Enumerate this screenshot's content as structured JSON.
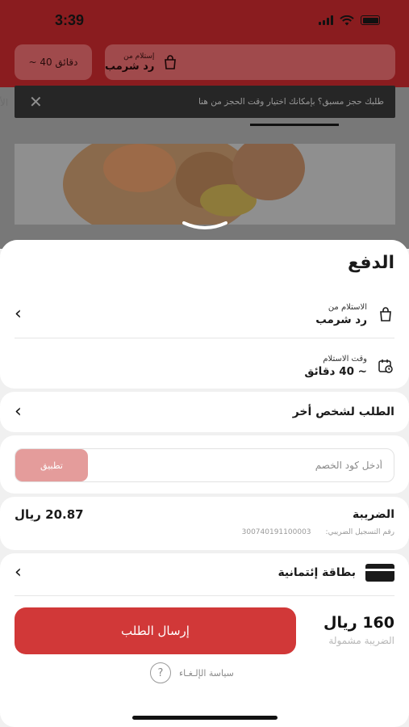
{
  "status_bar": {
    "time": "3:39"
  },
  "background": {
    "time_pill": "~ 40 دقائق",
    "pickup_label": "إستلام من",
    "pickup_name": "رد شرمب",
    "banner_text": "طلبك حجز مسبق؟ بإمكانك اختيار وقت الحجز من هنا"
  },
  "sheet": {
    "title": "الدفع",
    "pickup": {
      "label": "الاستلام من",
      "value": "رد شرمب"
    },
    "pickup_time": {
      "label": "وقت الاستلام",
      "value": "~ 40 دقائق"
    },
    "order_for_other": {
      "label": "الطلب لشخص أخر"
    },
    "coupon": {
      "placeholder": "أدخل كود الخصم",
      "apply_label": "تطبيق"
    },
    "tax": {
      "label": "الضريبة",
      "amount": "20.87 ريال",
      "vat_label": "رقم التسجيل الضريبي:",
      "vat_number": "300740191100003"
    },
    "payment": {
      "label": "بطاقة إئتمانية"
    },
    "submit_label": "إرسال الطلب",
    "total": {
      "amount": "160 ريال",
      "note": "الضريبة مشمولة"
    },
    "policy": {
      "label": "سياسة الإلـغـاء",
      "icon": "?"
    }
  },
  "colors": {
    "accent": "#d13838",
    "apply_button": "#e49c9b",
    "header_dim": "#8a1c1f"
  }
}
